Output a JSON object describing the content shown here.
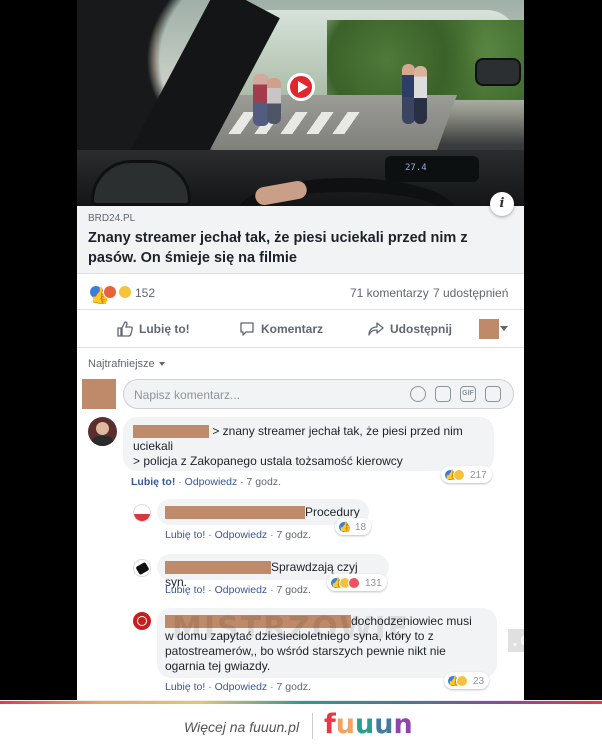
{
  "post": {
    "video": {
      "dashboard_display": "27.4"
    },
    "link": {
      "source": "BRD24.PL",
      "headline": "Znany streamer jechał tak, że piesi uciekali przed nim z pasów. On śmieje się na filmie"
    },
    "stats": {
      "reaction_count": "152",
      "comments": "71 komentarzy",
      "shares": "7 udostępnień"
    },
    "actions": {
      "like": "Lubię to!",
      "comment": "Komentarz",
      "share": "Udostępnij"
    },
    "sort_label": "Najtrafniejsze",
    "comment_placeholder": "Napisz komentarz..."
  },
  "comments": [
    {
      "line1": "> znany streamer jechał tak, że piesi przed nim",
      "line2": "uciekali",
      "line3": "> policja z Zakopanego ustala tożsamość kierowcy",
      "reactions": "217",
      "like": "Lubię to!",
      "reply": "Odpowiedz",
      "time": "7 godz."
    },
    {
      "text": "Procedury",
      "reactions": "18",
      "like": "Lubię to!",
      "reply": "Odpowiedz",
      "time": "7 godz."
    },
    {
      "text": "Sprawdzają czyj syn.",
      "reactions": "131",
      "like": "Lubię to!",
      "reply": "Odpowiedz",
      "time": "7 godz."
    },
    {
      "line1": "dochodzeniowiec musi",
      "line2": "w domu zapytać dziesiecioletniego syna, który to z",
      "line3": "patostreamerów,, bo wśród starszych pewnie nikt nie",
      "line4": "ogarnia tej gwiazdy.",
      "reactions": "23",
      "like": "Lubię to!",
      "reply": "Odpowiedz",
      "time": "7 godz."
    }
  ],
  "watermark": {
    "main": "MISTRZOWIE",
    "suffix": ".ORG"
  },
  "footer": {
    "text": "Więcej na fuuun.pl",
    "logo": [
      "f",
      "u",
      "u",
      "u",
      "n"
    ]
  },
  "colors": {
    "redaction": "#bf8a69",
    "link_blue": "#385898",
    "like_blue": "#3b7ddd"
  }
}
